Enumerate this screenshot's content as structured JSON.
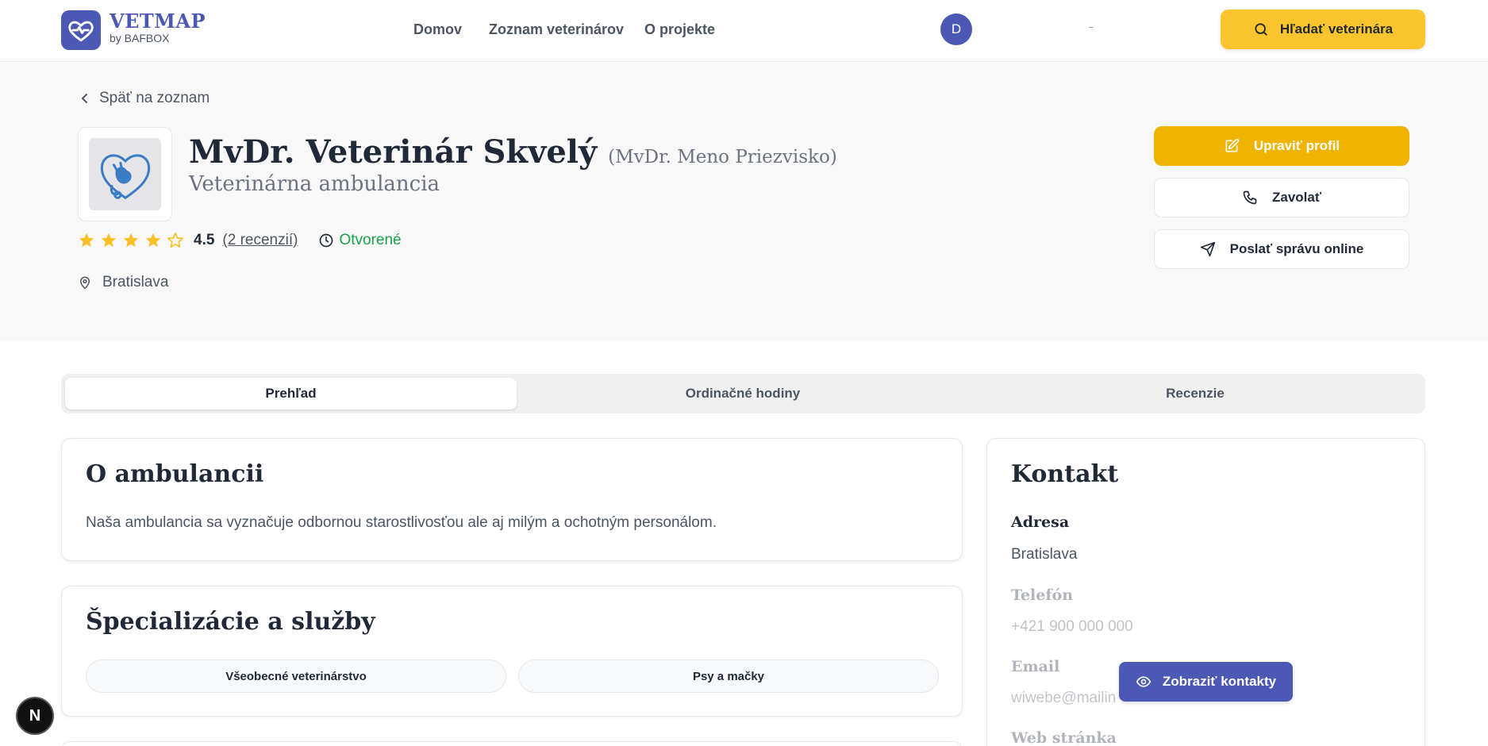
{
  "header": {
    "brand": "VETMAP",
    "brand_sub": "by BAFBOX",
    "nav": [
      "Domov",
      "Zoznam veterinárov",
      "O projekte"
    ],
    "avatar_initial": "D",
    "search_label": "Hľadať veterinára"
  },
  "profile": {
    "back_label": "Späť na zoznam",
    "name": "MvDr. Veterinár Skvelý",
    "alt_name": "(MvDr. Meno Priezvisko)",
    "type": "Veterinárna ambulancia",
    "rating": "4.5",
    "rating_value": 4.5,
    "reviews_label": "(2 recenzií)",
    "status": "Otvorené",
    "location": "Bratislava",
    "buttons": {
      "edit": "Upraviť profil",
      "call": "Zavolať",
      "message": "Poslať správu online"
    }
  },
  "tabs": [
    "Prehľad",
    "Ordinačné hodiny",
    "Recenzie"
  ],
  "about": {
    "title": "O ambulancii",
    "text": "Naša ambulancia sa vyznačuje odbornou starostlivosťou ale aj milým a ochotným personálom."
  },
  "services": {
    "title": "Špecializácie a služby",
    "items": [
      "Všeobecné veterinárstvo",
      "Psy a mačky"
    ]
  },
  "contact": {
    "title": "Kontakt",
    "address_label": "Adresa",
    "address": "Bratislava",
    "phone_label": "Telefón",
    "phone": "+421 900 000 000",
    "email_label": "Email",
    "email": "wiwebe@mailin",
    "web_label": "Web stránka",
    "show_button": "Zobraziť kontakty"
  },
  "dev_badge": "N",
  "colors": {
    "primary": "#4b59b5",
    "accent_yellow": "#fcc52e",
    "edit_yellow": "#f0b400",
    "open_green": "#16a34a",
    "star": "#fbbf24"
  }
}
